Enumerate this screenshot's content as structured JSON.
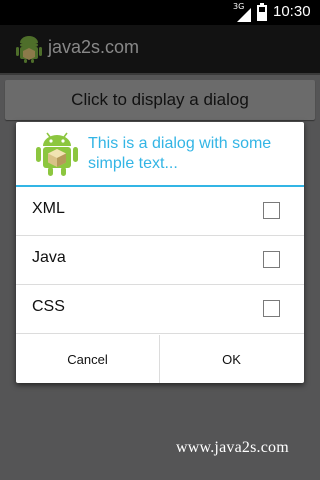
{
  "status_bar": {
    "network_type": "3G",
    "time": "10:30",
    "icons": [
      "signal-icon",
      "battery-icon"
    ]
  },
  "app": {
    "title": "java2s.com",
    "icon": "android-icon",
    "button_label": "Click to display a dialog",
    "watermark": "www.java2s.com"
  },
  "dialog": {
    "icon": "android-icon",
    "title": "This is a dialog with some simple text...",
    "accent_color": "#33b5e5",
    "options": [
      {
        "label": "XML",
        "checked": false
      },
      {
        "label": "Java",
        "checked": false
      },
      {
        "label": "CSS",
        "checked": false
      }
    ],
    "cancel_label": "Cancel",
    "ok_label": "OK"
  }
}
